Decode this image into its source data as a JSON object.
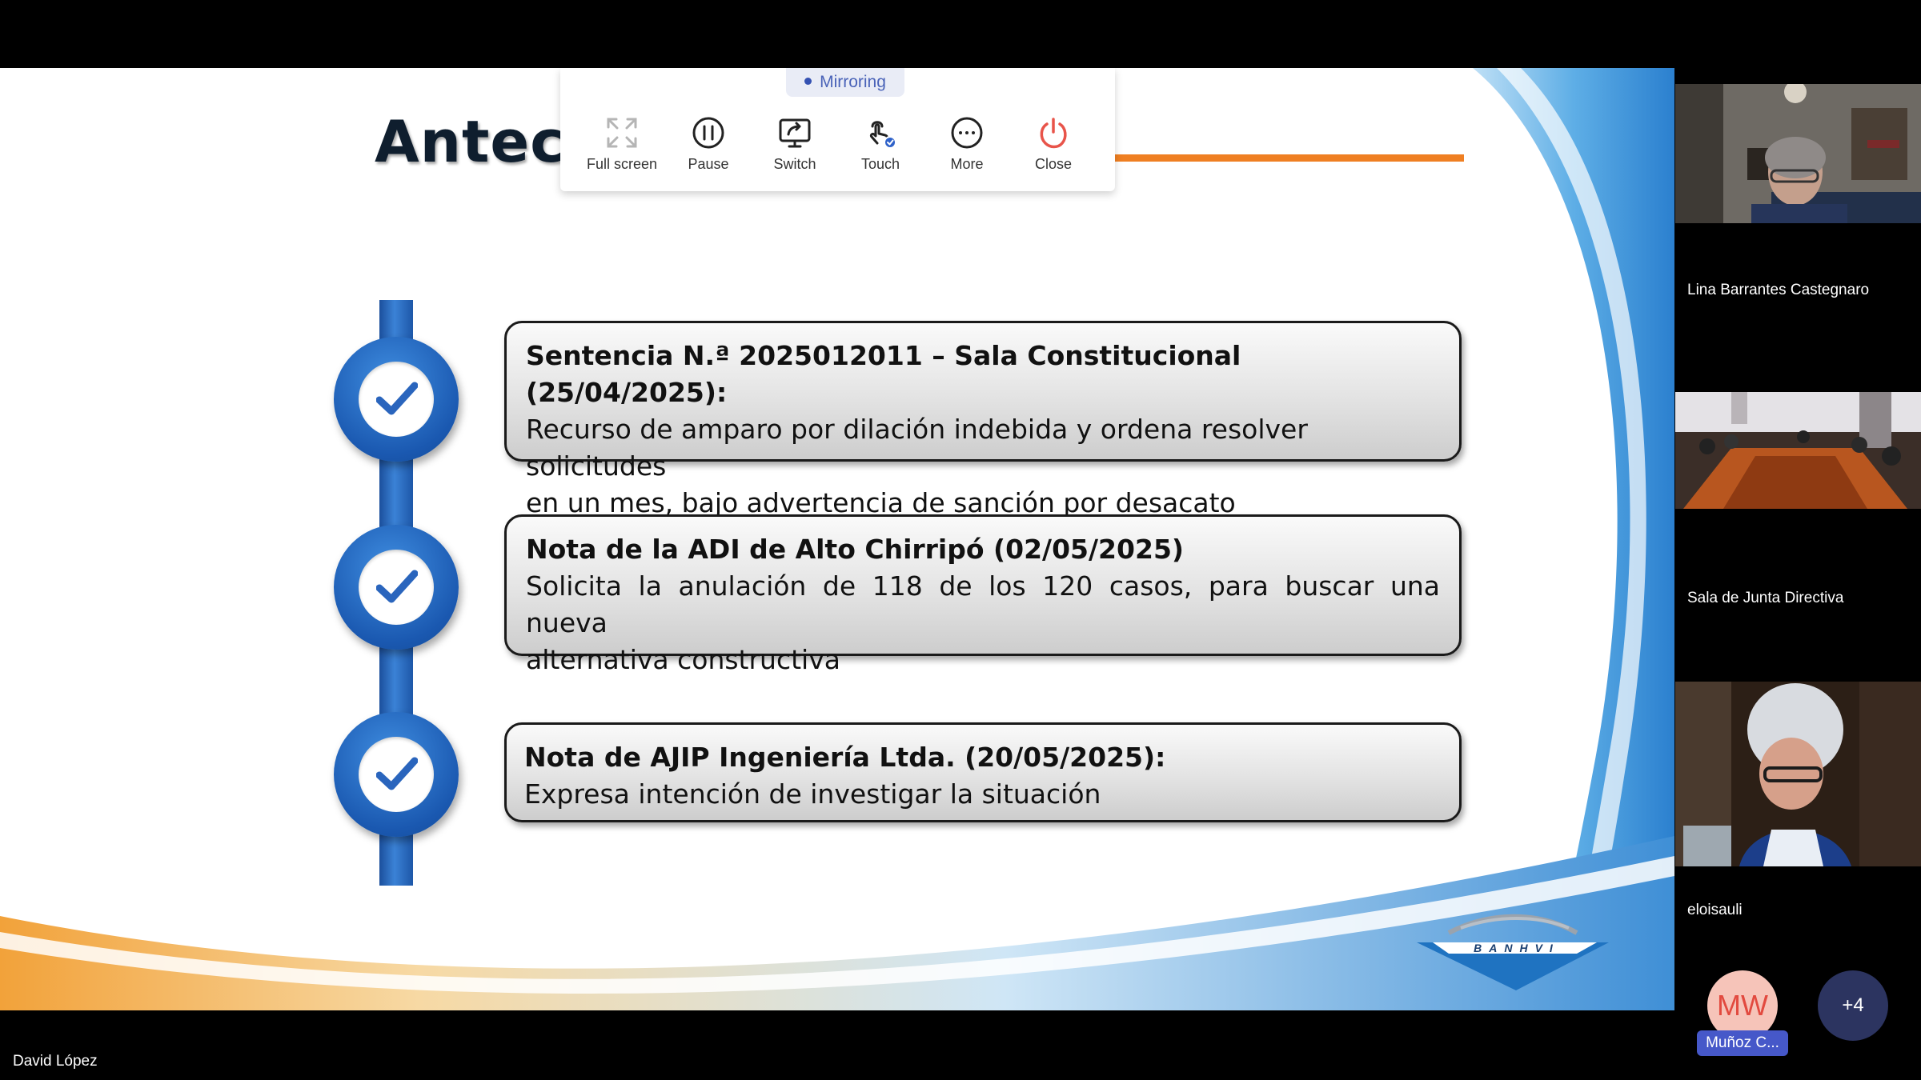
{
  "slide": {
    "title_visible": "Antece",
    "items": [
      {
        "title": "Sentencia N.ª 2025012011 – Sala Constitucional (25/04/2025):",
        "body_line1": "Recurso de amparo por dilación indebida y ordena resolver solicitudes",
        "body_line2": "en un mes, bajo advertencia de sanción por desacato"
      },
      {
        "title": "Nota de la ADI de Alto Chirripó (02/05/2025)",
        "body_line1": "Solicita la anulación de 118 de los 120 casos, para buscar una nueva",
        "body_line2": "alternativa constructiva"
      },
      {
        "title": "Nota de AJIP Ingeniería Ltda. (20/05/2025):",
        "body_line1": "Expresa intención de investigar la situación"
      }
    ],
    "logo_text": "BANHVI",
    "colors": {
      "accent_orange": "#ef7f22",
      "timeline_blue": "#1d57a8"
    }
  },
  "toolbar": {
    "status": "Mirroring",
    "buttons": [
      {
        "label": "Full screen",
        "icon": "expand-icon"
      },
      {
        "label": "Pause",
        "icon": "pause-icon"
      },
      {
        "label": "Switch",
        "icon": "switch-screen-icon"
      },
      {
        "label": "Touch",
        "icon": "touch-icon"
      },
      {
        "label": "More",
        "icon": "more-icon"
      },
      {
        "label": "Close",
        "icon": "power-icon"
      }
    ]
  },
  "participants": [
    {
      "name": "Lina Barrantes Castegnaro"
    },
    {
      "name": "Sala de Junta Directiva"
    },
    {
      "name": "eloisauli"
    }
  ],
  "bottom": {
    "avatar_initials": "MW",
    "avatar_label": "Muñoz C...",
    "more_count": "+4",
    "speaker_name": "David López"
  }
}
